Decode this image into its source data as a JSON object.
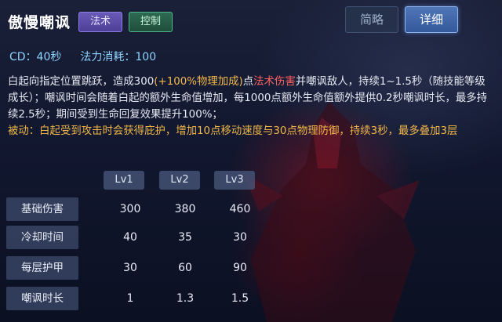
{
  "skill": {
    "name": "傲慢嘲讽",
    "tags": [
      "法术",
      "控制"
    ]
  },
  "view_toggle": {
    "brief": "简略",
    "detail": "详细",
    "active": "详细"
  },
  "stats": {
    "cd": "CD：40秒",
    "mana": "法力消耗：100"
  },
  "description": {
    "p1_a": "白起向指定位置跳跃，造成300",
    "p1_b": "(+100%物理加成)",
    "p1_c": "点",
    "p1_d": "法术伤害",
    "p1_e": "并嘲讽敌人，持续1~1.5秒（随技能等级成长）；嘲讽时间会随着白起的额外生命值增加，每1000点额外生命值额外提供0.2秒嘲讽时长，最多持续2.5秒；期间受到生命回复效果提升100%；",
    "passive": "被动：白起受到攻击时会获得庇护，增加10点移动速度与30点物理防御，持续3秒，最多叠加3层"
  },
  "levels": [
    "Lv1",
    "Lv2",
    "Lv3"
  ],
  "table": [
    {
      "label": "基础伤害",
      "values": [
        "300",
        "380",
        "460"
      ]
    },
    {
      "label": "冷却时间",
      "values": [
        "40",
        "35",
        "30"
      ]
    },
    {
      "label": "每层护甲",
      "values": [
        "30",
        "60",
        "90"
      ]
    },
    {
      "label": "嘲讽时长",
      "values": [
        "1",
        "1.3",
        "1.5"
      ]
    }
  ],
  "colors": {
    "magic_tag": "#5a4aa8",
    "control_tag": "#2f6a52",
    "highlight_yellow": "#f2b84a",
    "highlight_red": "#ff6060",
    "cd_text": "#8fd3ff"
  }
}
